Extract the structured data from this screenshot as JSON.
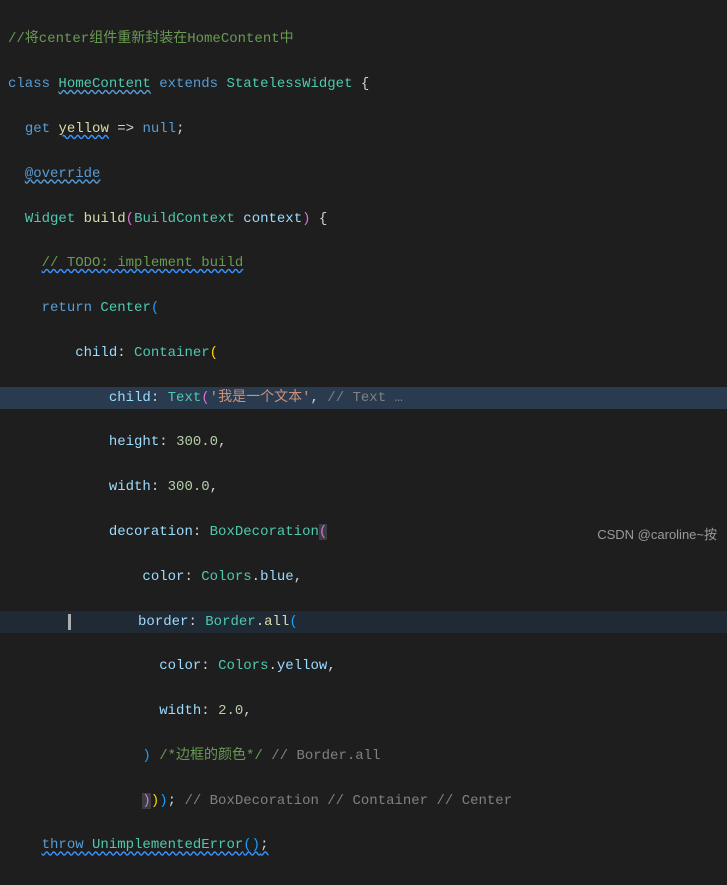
{
  "code": {
    "l1_comment": "//将center组件重新封装在HomeContent中",
    "l2_kw1": "class",
    "l2_cls": "HomeContent",
    "l2_kw2": "extends",
    "l2_sup": "StatelessWidget",
    "l2_br": " {",
    "l3_get": "get",
    "l3_name": "yellow",
    "l3_arrow": " => ",
    "l3_null": "null",
    "l3_semi": ";",
    "l4_anno": "@override",
    "l5_ret": "Widget",
    "l5_fn": "build",
    "l5_p1": "(",
    "l5_ptype": "BuildContext",
    "l5_pname": " context",
    "l5_p2": ")",
    "l5_br": " {",
    "l6_todo": "// TODO: implement build",
    "l7_ret": "return",
    "l7_ctor": " Center",
    "l7_p": "(",
    "l8_prop": "child",
    "l8_col": ": ",
    "l8_ctor": "Container",
    "l8_p": "(",
    "l9_prop": "child",
    "l9_col": ": ",
    "l9_ctor": "Text",
    "l9_p": "(",
    "l9_str": "'我是一个文本'",
    "l9_c": ",",
    "l9_hint": " // Text …",
    "l10_prop": "height",
    "l10_col": ": ",
    "l10_num": "300.0",
    "l10_c": ",",
    "l11_prop": "width",
    "l11_col": ": ",
    "l11_num": "300.0",
    "l11_c": ",",
    "l12_prop": "decoration",
    "l12_col": ": ",
    "l12_ctor": "BoxDecoration",
    "l12_p": "(",
    "l13_prop": "color",
    "l13_col": ": ",
    "l13_cls": "Colors",
    "l13_dot": ".",
    "l13_m": "blue",
    "l13_c": ",",
    "l14_prop": "border",
    "l14_col": ": ",
    "l14_cls": "Border",
    "l14_dot": ".",
    "l14_fn": "all",
    "l14_p": "(",
    "l15_prop": "color",
    "l15_col": ": ",
    "l15_cls": "Colors",
    "l15_dot": ".",
    "l15_m": "yellow",
    "l15_c": ",",
    "l16_prop": "width",
    "l16_col": ": ",
    "l16_num": "2.0",
    "l16_c": ",",
    "l17_p": ")",
    "l17_com": " /*边框的颜色*/",
    "l17_hint": " // Border.all",
    "l18_p1": ")",
    "l18_p2": ")",
    "l18_p3": ")",
    "l18_semi": ";",
    "l18_hint": " // BoxDecoration // Container // Center",
    "l19_kw": "throw",
    "l19_ctor": " UnimplementedError",
    "l19_p": "()",
    "l19_semi": ";"
  },
  "watermark": "CSDN @caroline~按"
}
